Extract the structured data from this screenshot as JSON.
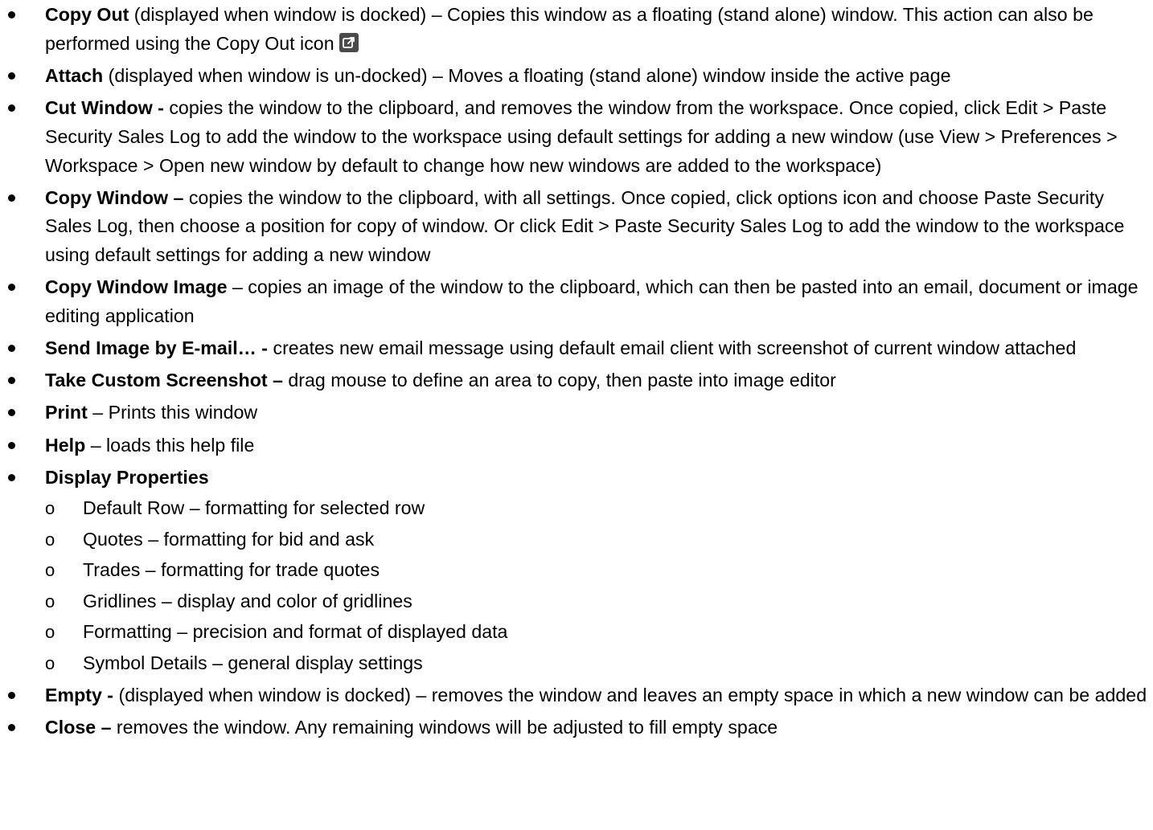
{
  "items": [
    {
      "term": "Copy Out",
      "desc": " (displayed when window is docked) – Copies this window as a floating (stand alone) window.  This action can also be performed using the Copy Out icon",
      "icon": "copy-out-icon"
    },
    {
      "term": "Attach",
      "desc": " (displayed when window is un-docked) – Moves a floating (stand alone) window inside the active page"
    },
    {
      "term": "Cut Window -",
      "desc": " copies the window to the clipboard, and removes the window from the workspace.  Once copied, click Edit > Paste Security Sales Log to add the window to the workspace using default settings for adding a new window  (use View > Preferences > Workspace > Open new window by default to change how new windows are added to the workspace)"
    },
    {
      "term": "Copy Window –",
      "desc": " copies the window to the clipboard, with all settings.  Once copied, click options icon and choose Paste Security Sales Log, then choose a position for copy of window.  Or click Edit > Paste Security Sales Log to add the window to the workspace using default settings for adding a new window"
    },
    {
      "term": "Copy Window Image",
      "desc": " – copies an image of the window to the clipboard, which can then be pasted into an email, document or image editing application"
    },
    {
      "term": "Send Image by E-mail… -",
      "desc": " creates new email message using default email client with screenshot of current window attached"
    },
    {
      "term": "Take Custom Screenshot –",
      "desc": " drag mouse to define an area to copy, then paste into image editor"
    },
    {
      "term": "Print",
      "desc": " – Prints this window"
    },
    {
      "term": "Help",
      "desc": " – loads this help file"
    },
    {
      "term": "Display Properties",
      "desc": "",
      "sub": [
        "Default Row – formatting for selected row",
        "Quotes – formatting for bid and ask",
        "Trades – formatting for trade quotes",
        "Gridlines – display and color of gridlines",
        "Formatting – precision and format of displayed data",
        "Symbol Details – general display settings"
      ]
    },
    {
      "term": "Empty -",
      "desc": " (displayed when window is docked) – removes the window and leaves an empty space in which a new window can be added"
    },
    {
      "term": "Close –",
      "desc": " removes the window.  Any remaining windows will be adjusted to fill empty space"
    }
  ]
}
